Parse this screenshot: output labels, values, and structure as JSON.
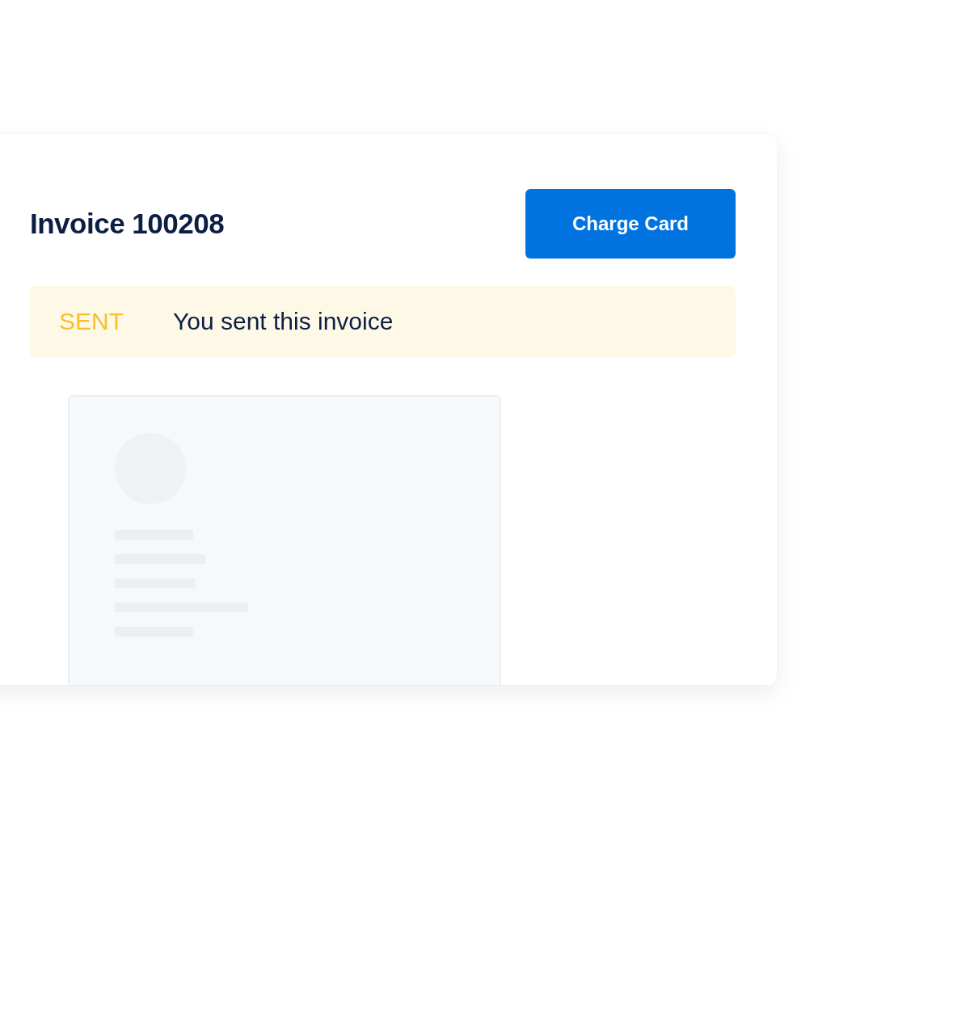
{
  "invoice": {
    "title": "Invoice 100208",
    "action": "Charge Card"
  },
  "status": {
    "kind": "sent",
    "label": "SENT",
    "message": "You sent this invoice"
  }
}
